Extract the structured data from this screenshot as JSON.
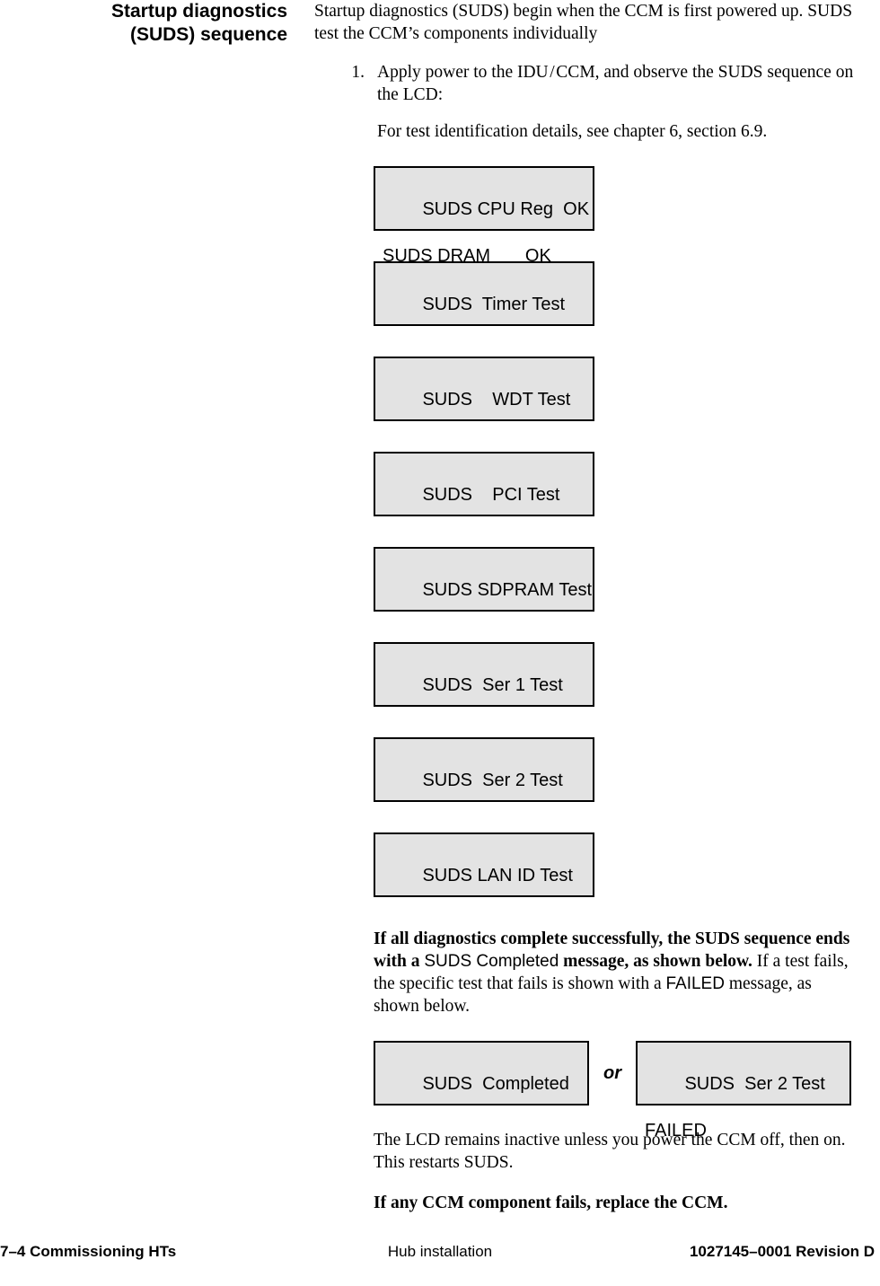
{
  "side_heading": {
    "line1": "Startup diagnostics",
    "line2": "(SUDS) sequence"
  },
  "intro": "Startup diagnostics (SUDS) begin when the CCM is first powered up. SUDS test the CCM’s components individually",
  "step": {
    "number": "1.",
    "text": "Apply power to the IDU / CCM, and observe the SUDS sequence on the LCD:",
    "subtext": "For test identification details, see chapter 6, section 6.9."
  },
  "lcd_screens": [
    {
      "line1": "SUDS CPU Reg  OK",
      "line2": "SUDS DRAM       OK"
    },
    {
      "line1": "SUDS  Timer Test",
      "line2": ""
    },
    {
      "line1": "SUDS    WDT Test",
      "line2": ""
    },
    {
      "line1": "SUDS    PCI Test",
      "line2": ""
    },
    {
      "line1": "SUDS SDPRAM Test",
      "line2": ""
    },
    {
      "line1": "SUDS  Ser 1 Test",
      "line2": ""
    },
    {
      "line1": "SUDS  Ser 2 Test",
      "line2": ""
    },
    {
      "line1": "SUDS LAN ID Test",
      "line2": ""
    }
  ],
  "narrative": {
    "bold1": "If all diagnostics complete successfully, the SUDS sequence ends with a ",
    "lcd1": "SUDS Completed",
    "bold2": " message, as shown below.",
    "plain1": " If a test fails, the specific test that fails is shown with a ",
    "lcd2": "FAILED",
    "plain2": " message, as shown below."
  },
  "or_row": {
    "left_lcd": {
      "line1": "SUDS  Completed",
      "line2": ""
    },
    "or_label": "or",
    "right_lcd": {
      "line1": "SUDS  Ser 2 Test",
      "line2": "FAILED"
    }
  },
  "after_or": "The LCD remains inactive unless you power the CCM off, then on. This restarts SUDS.",
  "bold_note": "If any CCM component fails, replace the CCM.",
  "footer": {
    "left": "7–4  Commissioning HTs",
    "center": "Hub installation",
    "right": "1027145–0001   Revision D"
  }
}
